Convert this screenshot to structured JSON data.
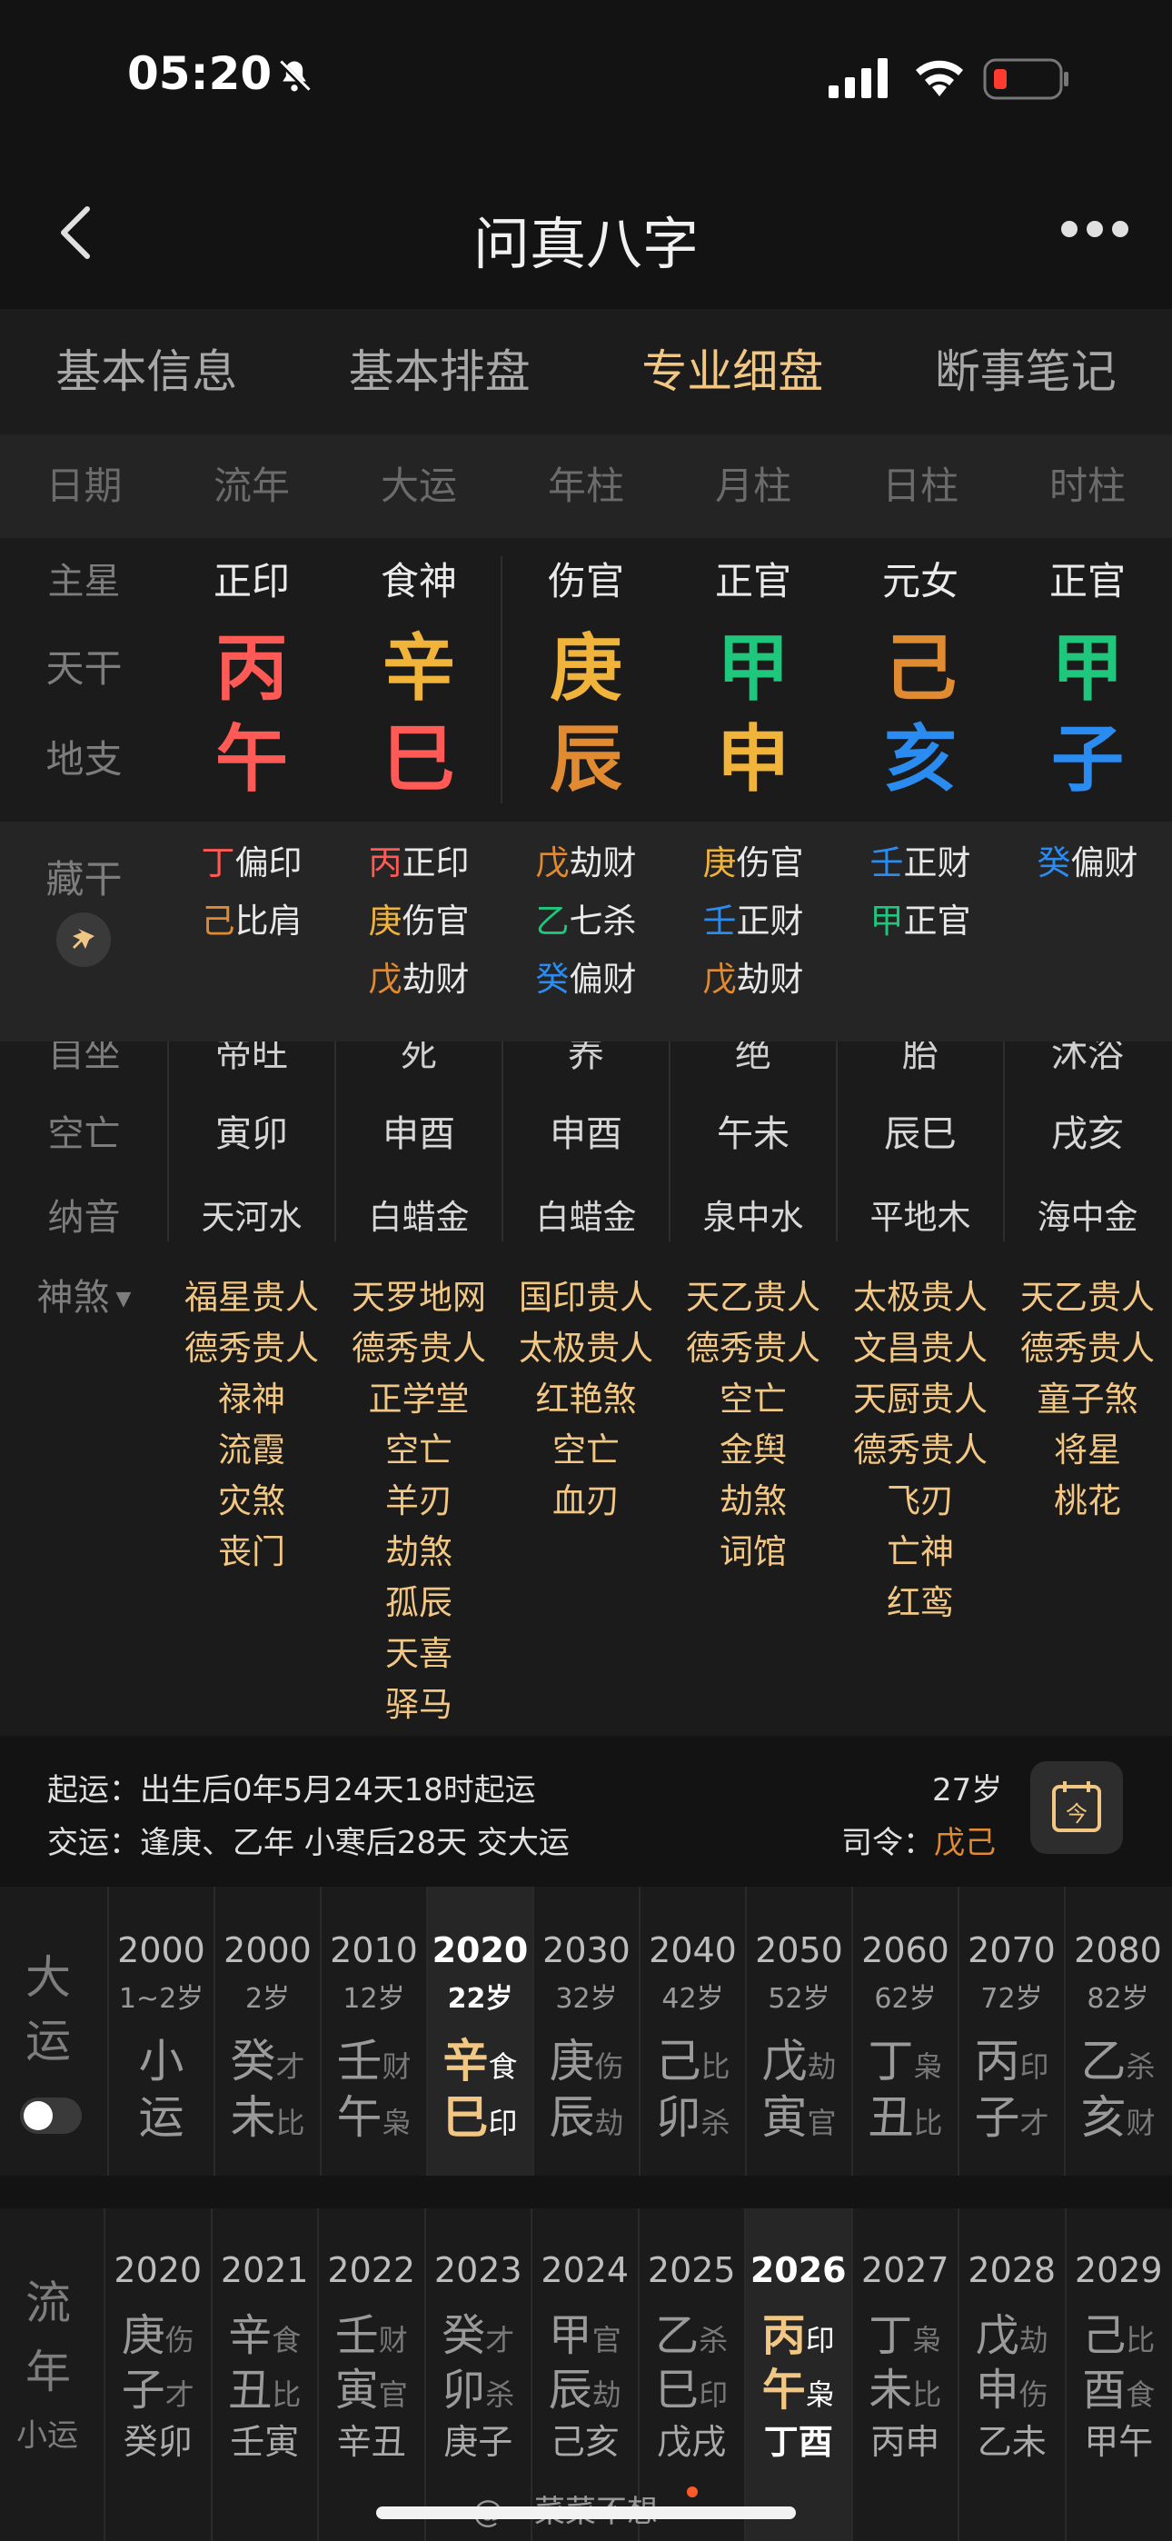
{
  "status": {
    "time": "05:20"
  },
  "nav": {
    "title": "问真八字"
  },
  "tabs": [
    {
      "label": "基本信息"
    },
    {
      "label": "基本排盘"
    },
    {
      "label": "专业细盘",
      "active": true
    },
    {
      "label": "断事笔记"
    }
  ],
  "header": {
    "label": "日期",
    "cols": [
      "流年",
      "大运",
      "年柱",
      "月柱",
      "日柱",
      "时柱"
    ]
  },
  "zhuxing": {
    "label": "主星",
    "cols": [
      "正印",
      "食神",
      "伤官",
      "正官",
      "元女",
      "正官"
    ]
  },
  "tiangan": {
    "label": "天干",
    "cols": [
      {
        "c": "丙",
        "color": "#ff5a55"
      },
      {
        "c": "辛",
        "color": "#f0b43a"
      },
      {
        "c": "庚",
        "color": "#f0b43a"
      },
      {
        "c": "甲",
        "color": "#1ec77c"
      },
      {
        "c": "己",
        "color": "#e08a32"
      },
      {
        "c": "甲",
        "color": "#1ec77c"
      }
    ]
  },
  "dizhi": {
    "label": "地支",
    "cols": [
      {
        "c": "午",
        "color": "#ff5a55"
      },
      {
        "c": "巳",
        "color": "#ff5a55"
      },
      {
        "c": "辰",
        "color": "#e08a32"
      },
      {
        "c": "申",
        "color": "#f0b43a"
      },
      {
        "c": "亥",
        "color": "#2a8cf0"
      },
      {
        "c": "子",
        "color": "#2a8cf0"
      }
    ]
  },
  "canggan": {
    "label": "藏干",
    "cols": [
      [
        {
          "g": "丁",
          "color": "#ff5a55",
          "s": "偏印"
        },
        {
          "g": "己",
          "color": "#e08a32",
          "s": "比肩"
        }
      ],
      [
        {
          "g": "丙",
          "color": "#ff5a55",
          "s": "正印"
        },
        {
          "g": "庚",
          "color": "#f0b43a",
          "s": "伤官"
        },
        {
          "g": "戊",
          "color": "#e08a32",
          "s": "劫财"
        }
      ],
      [
        {
          "g": "戊",
          "color": "#e08a32",
          "s": "劫财"
        },
        {
          "g": "乙",
          "color": "#1ec77c",
          "s": "七杀"
        },
        {
          "g": "癸",
          "color": "#2a8cf0",
          "s": "偏财"
        }
      ],
      [
        {
          "g": "庚",
          "color": "#f0b43a",
          "s": "伤官"
        },
        {
          "g": "壬",
          "color": "#2a8cf0",
          "s": "正财"
        },
        {
          "g": "戊",
          "color": "#e08a32",
          "s": "劫财"
        }
      ],
      [
        {
          "g": "壬",
          "color": "#2a8cf0",
          "s": "正财"
        },
        {
          "g": "甲",
          "color": "#1ec77c",
          "s": "正官"
        }
      ],
      [
        {
          "g": "癸",
          "color": "#2a8cf0",
          "s": "偏财"
        }
      ]
    ]
  },
  "zizuo": {
    "label": "自坐",
    "cols": [
      "帝旺",
      "死",
      "养",
      "绝",
      "胎",
      "沐浴"
    ]
  },
  "kongwang": {
    "label": "空亡",
    "cols": [
      "寅卯",
      "申酉",
      "申酉",
      "午未",
      "辰巳",
      "戌亥"
    ]
  },
  "nayin": {
    "label": "纳音",
    "cols": [
      "天河水",
      "白蜡金",
      "白蜡金",
      "泉中水",
      "平地木",
      "海中金"
    ]
  },
  "shensha": {
    "label": "神煞",
    "cols": [
      [
        "福星贵人",
        "德秀贵人",
        "禄神",
        "流霞",
        "灾煞",
        "丧门"
      ],
      [
        "天罗地网",
        "德秀贵人",
        "正学堂",
        "空亡",
        "羊刃",
        "劫煞",
        "孤辰",
        "天喜",
        "驿马"
      ],
      [
        "国印贵人",
        "太极贵人",
        "红艳煞",
        "空亡",
        "血刃"
      ],
      [
        "天乙贵人",
        "德秀贵人",
        "空亡",
        "金舆",
        "劫煞",
        "词馆"
      ],
      [
        "太极贵人",
        "文昌贵人",
        "天厨贵人",
        "德秀贵人",
        "飞刃",
        "亡神",
        "红鸾"
      ],
      [
        "天乙贵人",
        "德秀贵人",
        "童子煞",
        "将星",
        "桃花"
      ]
    ]
  },
  "qiyun": {
    "line1": "起运：出生后0年5月24天18时起运",
    "line2": "交运：逢庚、乙年 小寒后28天 交大运",
    "age": "27岁",
    "siling_label": "司令：",
    "siling_value": "戊己"
  },
  "dayun": {
    "title_top": "大",
    "title_bottom": "运",
    "items": [
      {
        "year": "2000",
        "age": "1~2岁",
        "g": "小",
        "gs": "",
        "z": "运",
        "zs": ""
      },
      {
        "year": "2000",
        "age": "2岁",
        "g": "癸",
        "gs": "才",
        "z": "未",
        "zs": "比"
      },
      {
        "year": "2010",
        "age": "12岁",
        "g": "壬",
        "gs": "财",
        "z": "午",
        "zs": "枭"
      },
      {
        "year": "2020",
        "age": "22岁",
        "g": "辛",
        "gs": "食",
        "z": "巳",
        "zs": "印",
        "active": true
      },
      {
        "year": "2030",
        "age": "32岁",
        "g": "庚",
        "gs": "伤",
        "z": "辰",
        "zs": "劫"
      },
      {
        "year": "2040",
        "age": "42岁",
        "g": "己",
        "gs": "比",
        "z": "卯",
        "zs": "杀"
      },
      {
        "year": "2050",
        "age": "52岁",
        "g": "戊",
        "gs": "劫",
        "z": "寅",
        "zs": "官"
      },
      {
        "year": "2060",
        "age": "62岁",
        "g": "丁",
        "gs": "枭",
        "z": "丑",
        "zs": "比"
      },
      {
        "year": "2070",
        "age": "72岁",
        "g": "丙",
        "gs": "印",
        "z": "子",
        "zs": "才"
      },
      {
        "year": "2080",
        "age": "82岁",
        "g": "乙",
        "gs": "杀",
        "z": "亥",
        "zs": "财"
      }
    ]
  },
  "liunian": {
    "title_top": "流",
    "title_bottom": "年",
    "sub": "小运",
    "items": [
      {
        "year": "2020",
        "g": "庚",
        "gs": "伤",
        "z": "子",
        "zs": "才",
        "x": "癸卯"
      },
      {
        "year": "2021",
        "g": "辛",
        "gs": "食",
        "z": "丑",
        "zs": "比",
        "x": "壬寅"
      },
      {
        "year": "2022",
        "g": "壬",
        "gs": "财",
        "z": "寅",
        "zs": "官",
        "x": "辛丑"
      },
      {
        "year": "2023",
        "g": "癸",
        "gs": "才",
        "z": "卯",
        "zs": "杀",
        "x": "庚子"
      },
      {
        "year": "2024",
        "g": "甲",
        "gs": "官",
        "z": "辰",
        "zs": "劫",
        "x": "己亥"
      },
      {
        "year": "2025",
        "g": "乙",
        "gs": "杀",
        "z": "巳",
        "zs": "印",
        "x": "戊戌"
      },
      {
        "year": "2026",
        "g": "丙",
        "gs": "印",
        "z": "午",
        "zs": "枭",
        "x": "丁酉",
        "active": true
      },
      {
        "year": "2027",
        "g": "丁",
        "gs": "枭",
        "z": "未",
        "zs": "比",
        "x": "丙申"
      },
      {
        "year": "2028",
        "g": "戊",
        "gs": "劫",
        "z": "申",
        "zs": "伤",
        "x": "乙未"
      },
      {
        "year": "2029",
        "g": "己",
        "gs": "比",
        "z": "酉",
        "zs": "食",
        "x": "甲午"
      }
    ]
  },
  "watermark": "@一菜菜不想一"
}
